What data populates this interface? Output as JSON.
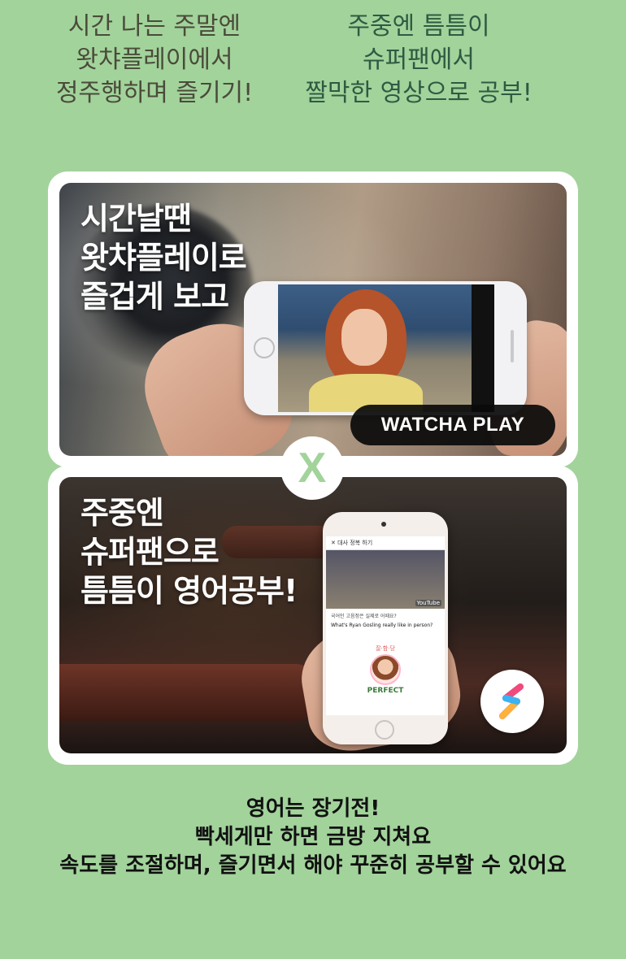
{
  "top_left": {
    "lines": [
      "시간 나는 주말엔",
      "왓챠플레이에서",
      "정주행하며 즐기기!"
    ]
  },
  "top_right": {
    "lines": [
      "주중엔 틈틈이",
      "슈퍼팬에서",
      "짤막한 영상으로 공부!"
    ]
  },
  "panel_watcha": {
    "title_lines": [
      "시간날땐",
      "왓챠플레이로",
      "즐겁게 보고"
    ],
    "badge_label": "WATCHA PLAY"
  },
  "separator": {
    "symbol": "X"
  },
  "panel_superfan": {
    "title_lines": [
      "주중엔",
      "슈퍼팬으로",
      "틈틈이 영어공부!"
    ],
    "phone_screen": {
      "header": "대사 정복 하기",
      "video_badge": "YouTube",
      "question_ko": "국어인 고음정은 실제로 어때요?",
      "question_en": "What's Ryan Gosling really like in person?",
      "rating_marks": "잘·함·당",
      "result_label": "PERFECT"
    }
  },
  "bottom": {
    "lines": [
      "영어는 장기전!",
      "빡세게만 하면 금방 지쳐요",
      "속도를 조절하며, 즐기면서 해야 꾸준히 공부할 수 있어요"
    ]
  },
  "colors": {
    "background": "#a2d39b",
    "top_left_text": "#4a4b3a",
    "top_right_text": "#2d5b42",
    "badge_bg": "#0a0a0a"
  }
}
